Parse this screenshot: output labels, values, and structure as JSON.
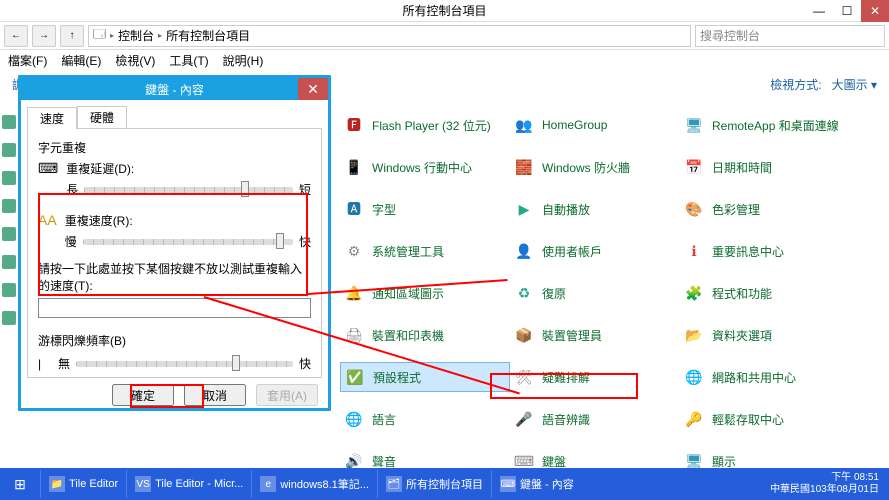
{
  "window": {
    "title": "所有控制台項目",
    "min": "—",
    "max": "☐",
    "close": "✕"
  },
  "nav": {
    "back": "←",
    "fwd": "→",
    "up": "↑",
    "bc1": "控制台",
    "bc2": "所有控制台項目",
    "search_placeholder": "搜尋控制台"
  },
  "menu": {
    "file": "檔案(F)",
    "edit": "編輯(E)",
    "view": "檢視(V)",
    "tools": "工具(T)",
    "help": "說明(H)"
  },
  "content_header": {
    "left": "調整電腦設定",
    "view_label": "檢視方式:",
    "view_value": "大圖示 ▾"
  },
  "cp": {
    "c1": [
      {
        "icon": "🅵",
        "label": "Flash Player (32 位元)",
        "color": "#b22"
      },
      {
        "icon": "📱",
        "label": "Windows 行動中心",
        "color": "#39b"
      },
      {
        "icon": "🅰",
        "label": "字型",
        "color": "#27a"
      },
      {
        "icon": "⚙",
        "label": "系統管理工具",
        "color": "#888"
      },
      {
        "icon": "🔔",
        "label": "通知區域圖示",
        "color": "#888"
      },
      {
        "icon": "🖨",
        "label": "裝置和印表機",
        "color": "#888"
      },
      {
        "icon": "✅",
        "label": "預設程式",
        "color": "#2a8"
      },
      {
        "icon": "🌐",
        "label": "語言",
        "color": "#39b"
      },
      {
        "icon": "🔊",
        "label": "聲音",
        "color": "#888"
      }
    ],
    "c2": [
      {
        "icon": "👥",
        "label": "HomeGroup",
        "color": "#2a8"
      },
      {
        "icon": "🧱",
        "label": "Windows 防火牆",
        "color": "#c44"
      },
      {
        "icon": "▶",
        "label": "自動播放",
        "color": "#2a8"
      },
      {
        "icon": "👤",
        "label": "使用者帳戶",
        "color": "#2a8"
      },
      {
        "icon": "♻",
        "label": "復原",
        "color": "#2a8"
      },
      {
        "icon": "📦",
        "label": "裝置管理員",
        "color": "#888"
      },
      {
        "icon": "🛠",
        "label": "疑難排解",
        "color": "#888"
      },
      {
        "icon": "🎤",
        "label": "語音辨識",
        "color": "#888"
      },
      {
        "icon": "⌨",
        "label": "鍵盤",
        "color": "#888"
      }
    ],
    "c3": [
      {
        "icon": "🖥",
        "label": "RemoteApp 和桌面連線",
        "color": "#39b"
      },
      {
        "icon": "📅",
        "label": "日期和時間",
        "color": "#39b"
      },
      {
        "icon": "🎨",
        "label": "色彩管理",
        "color": "#39b"
      },
      {
        "icon": "ℹ",
        "label": "重要訊息中心",
        "color": "#c44"
      },
      {
        "icon": "🧩",
        "label": "程式和功能",
        "color": "#888"
      },
      {
        "icon": "📂",
        "label": "資料夾選項",
        "color": "#da5"
      },
      {
        "icon": "🌐",
        "label": "網路和共用中心",
        "color": "#39b"
      },
      {
        "icon": "🔑",
        "label": "輕鬆存取中心",
        "color": "#39b"
      },
      {
        "icon": "🖥",
        "label": "顯示",
        "color": "#39b"
      }
    ]
  },
  "dialog": {
    "title": "鍵盤 - 內容",
    "tab_speed": "速度",
    "tab_hw": "硬體",
    "grp_repeat": "字元重複",
    "lbl_delay": "重複延遲(D):",
    "delay_left": "長",
    "delay_right": "短",
    "lbl_rate": "重複速度(R):",
    "rate_left": "慢",
    "rate_right": "快",
    "lbl_test": "請按一下此處並按下某個按鍵不放以測試重複輸入的速度(T):",
    "grp_blink": "游標閃爍頻率(B)",
    "blink_left": "無",
    "blink_right": "快",
    "ok": "確定",
    "cancel": "取消",
    "apply": "套用(A)"
  },
  "taskbar": {
    "items": [
      {
        "icon": "📁",
        "label": "Tile Editor"
      },
      {
        "icon": "VS",
        "label": "Tile Editor - Micr..."
      },
      {
        "icon": "e",
        "label": "windows8.1筆記..."
      },
      {
        "icon": "🗂",
        "label": "所有控制台項目"
      },
      {
        "icon": "⌨",
        "label": "鍵盤 - 內容"
      }
    ],
    "time": "下午 08:51",
    "date": "中華民國103年08月01日"
  }
}
